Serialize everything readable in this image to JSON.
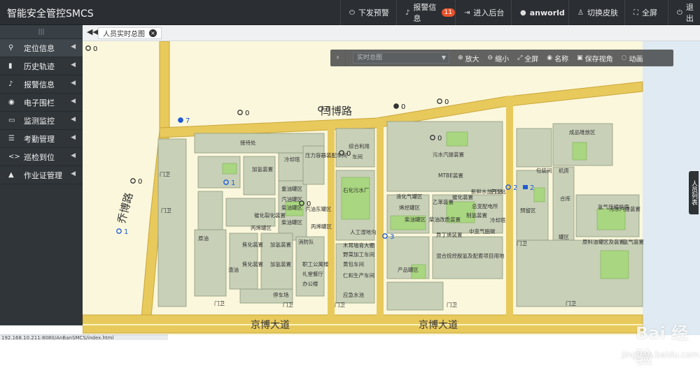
{
  "app": {
    "title": "智能安全管控SMCS"
  },
  "topbar": {
    "items": [
      {
        "icon": "power-icon",
        "label": "下发预警"
      },
      {
        "icon": "bell-icon",
        "label": "报警信息",
        "badge": "11"
      },
      {
        "icon": "enter-icon",
        "label": "进入后台"
      },
      {
        "icon": "user-icon",
        "label": "anworld"
      },
      {
        "icon": "shirt-icon",
        "label": "切换皮肤"
      },
      {
        "icon": "fullscreen-icon",
        "label": "全屏"
      },
      {
        "icon": "logout-icon",
        "label": "退出"
      }
    ]
  },
  "sidebar": {
    "grip": "|||",
    "items": [
      {
        "label": "定位信息"
      },
      {
        "label": "历史轨迹"
      },
      {
        "label": "报警信息"
      },
      {
        "label": "电子围栏"
      },
      {
        "label": "监测监控"
      },
      {
        "label": "考勤管理"
      },
      {
        "label": "巡检到位"
      },
      {
        "label": "作业证管理"
      }
    ]
  },
  "tabs": {
    "active": "人员实时总图",
    "close": "×"
  },
  "map_toolbar": {
    "expand": "›",
    "select_placeholder": "实时总图",
    "zoom_in": "放大",
    "zoom_out": "缩小",
    "fullscreen": "全屏",
    "names": "名称",
    "save_view": "保存视角",
    "animate": "动画"
  },
  "side_tab": "人员列表",
  "status_url": "192.168.10.211:8080/AnBanSMCS/index.html",
  "map": {
    "roads": {
      "top": "闫博路",
      "left": "乔博路",
      "bottom_left": "京博大道",
      "bottom_right": "京博大道"
    },
    "counters": [
      {
        "kind": "target",
        "value": "0"
      },
      {
        "kind": "target",
        "value": "0"
      },
      {
        "kind": "target",
        "value": "0"
      },
      {
        "kind": "target",
        "value": "0"
      },
      {
        "kind": "target",
        "value": "0"
      },
      {
        "kind": "target",
        "value": "0"
      },
      {
        "kind": "target",
        "value": "0"
      },
      {
        "kind": "target",
        "value": "0"
      },
      {
        "kind": "globe-blue",
        "value": "7"
      },
      {
        "kind": "target-blue",
        "value": "1"
      },
      {
        "kind": "target-blue",
        "value": "1"
      },
      {
        "kind": "target-blue",
        "value": "3"
      },
      {
        "kind": "target-blue",
        "value": "2"
      },
      {
        "kind": "square-blue",
        "value": "2"
      },
      {
        "kind": "globe",
        "value": "0"
      }
    ],
    "labels": [
      "接待处",
      "综合利用",
      "车间",
      "压力容器装配车间",
      "加氢装置",
      "冷却塔",
      "重油罐区",
      "汽油罐区",
      "柴油罐区",
      "汽油东罐区",
      "催化裂化装置",
      "丙烯罐区",
      "柴油罐区",
      "丙烯罐区",
      "石化污水厂",
      "人工湿地沟",
      "原油",
      "焦化装置",
      "加氢装置",
      "消防队",
      "木耳墙育大棚",
      "野菜加工车间",
      "黄包车间",
      "焦化装置",
      "加氢装置",
      "职工公寓楼",
      "礼堂餐厅",
      "办公楼",
      "渣油",
      "仁和生产车间",
      "停车场",
      "应急水池",
      "门卫",
      "门卫",
      "门卫",
      "门卫",
      "门卫",
      "门卫",
      "门卫",
      "门卫",
      "液化气罐区",
      "烯烃罐区",
      "柴油罐区",
      "柴油改质装置",
      "制氢装置",
      "异丁烯装置",
      "中变气脱碳",
      "混合烷烃脱氢及配套项目用地",
      "产品罐区",
      "成品堆放区",
      "包装间",
      "机房",
      "合库",
      "罐区",
      "预留区",
      "新鲜水加压站",
      "空压站",
      "总变配电所",
      "冷却塔",
      "MTBE装置",
      "污水汽提装置",
      "催化装置",
      "乙苯装置",
      "原料油罐区及装置",
      "污水汽提装置",
      "氢气压缩机房",
      "氢气装置"
    ]
  },
  "watermark": {
    "text": "Bai 经验",
    "url": "jingyan.baidu.com"
  }
}
